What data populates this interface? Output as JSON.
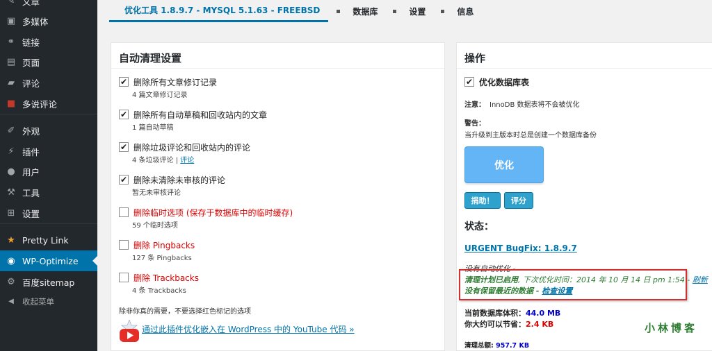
{
  "sidebar": {
    "items": [
      {
        "label": "文章",
        "icon": "pin-icon",
        "glyph": "✎"
      },
      {
        "label": "多媒体",
        "icon": "media-icon",
        "glyph": "▣"
      },
      {
        "label": "链接",
        "icon": "link-icon",
        "glyph": "⚭"
      },
      {
        "label": "页面",
        "icon": "page-icon",
        "glyph": "▤"
      },
      {
        "label": "评论",
        "icon": "comment-icon",
        "glyph": "▰"
      },
      {
        "label": "多说评论",
        "icon": "duoshuo-icon",
        "glyph": "■"
      },
      {
        "label": "外观",
        "icon": "appearance-icon",
        "glyph": "✐"
      },
      {
        "label": "插件",
        "icon": "plugin-icon",
        "glyph": "⚡"
      },
      {
        "label": "用户",
        "icon": "user-icon",
        "glyph": "●"
      },
      {
        "label": "工具",
        "icon": "wrench-icon",
        "glyph": "⚒"
      },
      {
        "label": "设置",
        "icon": "settings-icon",
        "glyph": "⊞"
      },
      {
        "label": "Pretty Link",
        "icon": "star-icon",
        "glyph": "★"
      },
      {
        "label": "WP-Optimize",
        "icon": "wp-optimize-icon",
        "glyph": "◉"
      },
      {
        "label": "百度sitemap",
        "icon": "gear-icon",
        "glyph": "⚙"
      },
      {
        "label": "收起菜单",
        "icon": "collapse-icon",
        "glyph": "◀"
      }
    ]
  },
  "tabs": [
    {
      "label": "优化工具 1.8.9.7 - MYSQL 5.1.63 - FREEBSD"
    },
    {
      "label": "数据库"
    },
    {
      "label": "设置"
    },
    {
      "label": "信息"
    }
  ],
  "left": {
    "title": "自动清理设置",
    "options": [
      {
        "label": "删除所有文章修订记录",
        "sub": "4 篇文章修订记录",
        "checked": true
      },
      {
        "label": "删除所有自动草稿和回收站内的文章",
        "sub": "1 篇自动草稿",
        "checked": true
      },
      {
        "label": "删除垃圾评论和回收站内的评论",
        "sub": "4 条垃圾评论 | ",
        "sub_link": "评论",
        "checked": true
      },
      {
        "label": "删除未清除未审核的评论",
        "sub": "暂无未审核评论",
        "checked": true
      },
      {
        "label": "删除临时选项 (保存于数据库中的临时缓存)",
        "sub": "59 个临时选项",
        "checked": false
      },
      {
        "label": "删除 Pingbacks",
        "sub": "127 条 Pingbacks",
        "checked": false
      },
      {
        "label": "删除 Trackbacks",
        "sub": "4 条 Trackbacks",
        "checked": false
      }
    ],
    "note": "除非你真的需要，不要选择红色标记的选项",
    "youtube_link": "通过此插件优化嵌入在 WordPress 中的 YouTube 代码 »"
  },
  "right": {
    "title": "操作",
    "optimize_table_label": "优化数据库表",
    "note_label": "注意：",
    "note_text": "InnoDB 数据表将不会被优化",
    "warning_label": "警告：",
    "warning_text": "当升级到主版本时总是创建一个数据库备份",
    "optimize_button": "优化",
    "donate_button": "捐助！",
    "rate_button": "评分",
    "status_title": "状态：",
    "bugfix_link": "URGENT BugFix: 1.8.9.7",
    "not_auto": "没有自动优化 -",
    "schedule_enabled": "清理计划已启用",
    "next_time": ", 下次优化时间：2014 年 10 月 14 日 pm 1:54 - ",
    "refresh_link": "刷新",
    "no_recent": "没有保留最近的数据 - ",
    "check_settings_link": "检查设置",
    "db_size_label": "当前数据库体积：",
    "db_size_value": "44.0 MB",
    "save_label": "你大约可以节省：",
    "save_value": "2.4 KB",
    "total_label": "清理总额: ",
    "total_value": "957.7 KB",
    "watermark": "小林博客"
  },
  "colors": {
    "accent": "#0073aa",
    "red": "#dd0000",
    "green": "#2e7d32"
  }
}
